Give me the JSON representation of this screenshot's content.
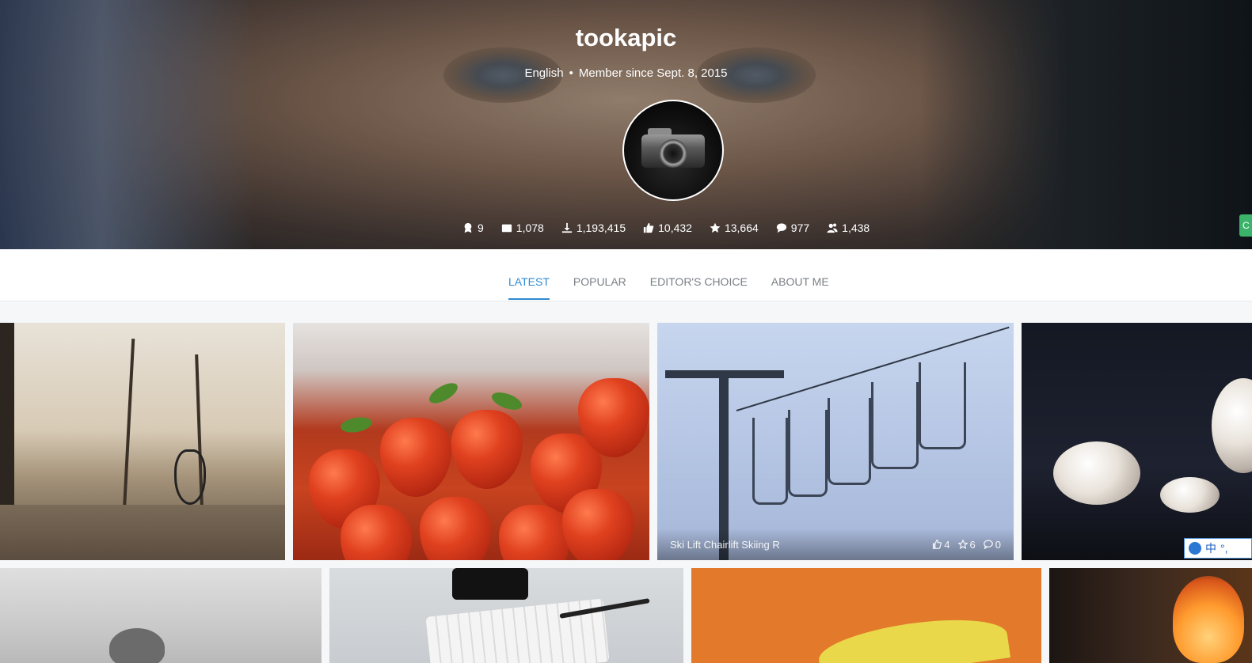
{
  "profile": {
    "name": "tookapic",
    "language": "English",
    "member_since": "Member since Sept. 8, 2015",
    "avatar_icon": "camera-avatar-icon"
  },
  "stats": [
    {
      "icon": "award-icon",
      "value": "9"
    },
    {
      "icon": "photos-icon",
      "value": "1,078"
    },
    {
      "icon": "download-icon",
      "value": "1,193,415"
    },
    {
      "icon": "thumbs-up-icon",
      "value": "10,432"
    },
    {
      "icon": "star-icon",
      "value": "13,664"
    },
    {
      "icon": "comment-icon",
      "value": "977"
    },
    {
      "icon": "followers-icon",
      "value": "1,438"
    }
  ],
  "tabs": [
    {
      "label": "LATEST",
      "active": true
    },
    {
      "label": "POPULAR",
      "active": false
    },
    {
      "label": "EDITOR'S CHOICE",
      "active": false
    },
    {
      "label": "ABOUT ME",
      "active": false
    }
  ],
  "hover_caption": {
    "title": "Ski Lift Chairlift Skiing R",
    "likes": "4",
    "favorites": "6",
    "comments": "0"
  },
  "ime_indicator": {
    "label": "中",
    "extra": "°,"
  },
  "side_button": {
    "label": "C"
  },
  "colors": {
    "accent": "#2f8bd0",
    "side_button": "#3bb36a"
  }
}
